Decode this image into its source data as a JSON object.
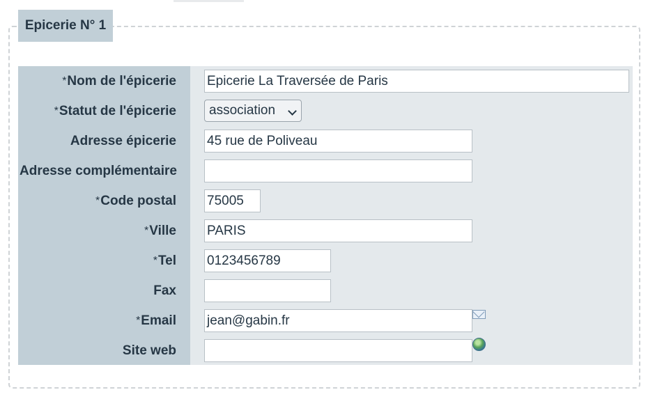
{
  "legend": "Epicerie N° 1",
  "required_mark": "*",
  "fields": [
    {
      "label": "Nom de l'épicerie",
      "required": true,
      "value": "Epicerie La Traversée de Paris"
    },
    {
      "label": "Statut de l'épicerie",
      "required": true,
      "value": "association"
    },
    {
      "label": "Adresse épicerie",
      "required": false,
      "value": "45 rue de Poliveau"
    },
    {
      "label": "Adresse complémentaire",
      "required": false,
      "value": ""
    },
    {
      "label": "Code postal",
      "required": true,
      "value": "75005"
    },
    {
      "label": "Ville",
      "required": true,
      "value": "PARIS"
    },
    {
      "label": "Tel",
      "required": true,
      "value": "0123456789"
    },
    {
      "label": "Fax",
      "required": false,
      "value": ""
    },
    {
      "label": "Email",
      "required": true,
      "value": "jean@gabin.fr"
    },
    {
      "label": "Site web",
      "required": false,
      "value": ""
    }
  ],
  "icons": {
    "email": "envelope-icon",
    "website": "globe-icon"
  }
}
